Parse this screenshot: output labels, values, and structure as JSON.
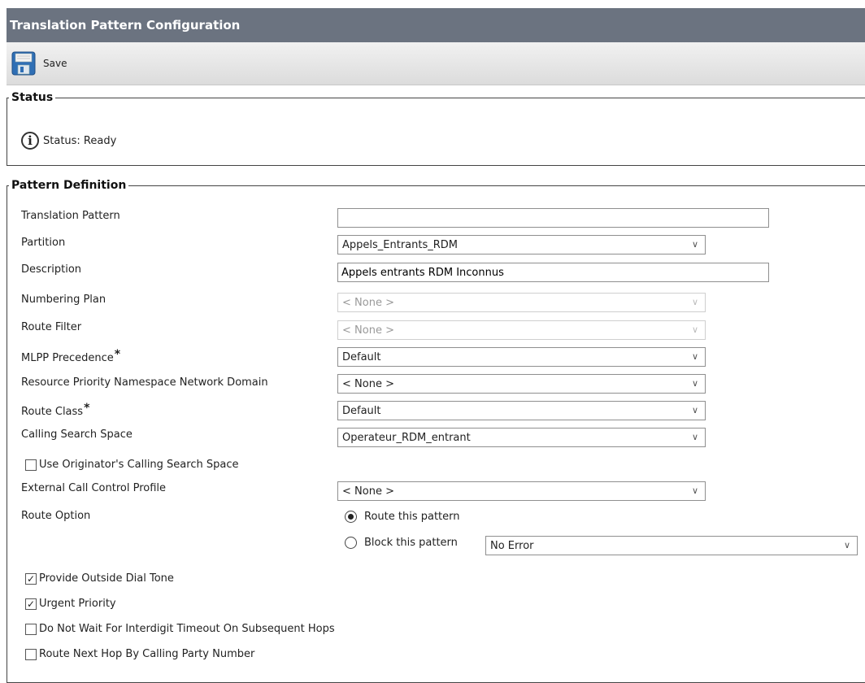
{
  "header": {
    "title": "Translation Pattern Configuration"
  },
  "toolbar": {
    "save_label": "Save"
  },
  "status": {
    "legend": "Status",
    "text": "Status: Ready"
  },
  "pattern": {
    "legend": "Pattern Definition",
    "translation_pattern": {
      "label": "Translation Pattern",
      "value": ""
    },
    "partition": {
      "label": "Partition",
      "value": "Appels_Entrants_RDM"
    },
    "description": {
      "label": "Description",
      "value": "Appels entrants RDM Inconnus"
    },
    "numbering_plan": {
      "label": "Numbering Plan",
      "value": "< None >"
    },
    "route_filter": {
      "label": "Route Filter",
      "value": "< None >"
    },
    "mlpp_precedence": {
      "label": "MLPP Precedence",
      "required": "*",
      "value": "Default"
    },
    "resource_priority": {
      "label": "Resource Priority Namespace Network Domain",
      "value": "< None >"
    },
    "route_class": {
      "label": "Route Class",
      "required": "*",
      "value": "Default"
    },
    "calling_search_space": {
      "label": "Calling Search Space",
      "value": "Operateur_RDM_entrant"
    },
    "use_originator_css": {
      "label": "Use Originator's Calling Search Space",
      "checked": false
    },
    "external_call_control": {
      "label": "External Call Control Profile",
      "value": "< None >"
    },
    "route_option": {
      "label": "Route Option",
      "route_label": "Route this pattern",
      "block_label": "Block this pattern",
      "block_reason": "No Error",
      "selected": "route"
    },
    "checkboxes": {
      "outside_dial_tone": {
        "label": "Provide Outside Dial Tone",
        "checked": true
      },
      "urgent_priority": {
        "label": "Urgent Priority",
        "checked": true
      },
      "no_interdigit_wait": {
        "label": "Do Not Wait For Interdigit Timeout On Subsequent Hops",
        "checked": false
      },
      "route_next_hop": {
        "label": "Route Next Hop By Calling Party Number",
        "checked": false
      }
    }
  },
  "icons": {
    "save": "save-floppy-icon",
    "info": "info-icon",
    "chevron": "chevron-down-icon"
  }
}
